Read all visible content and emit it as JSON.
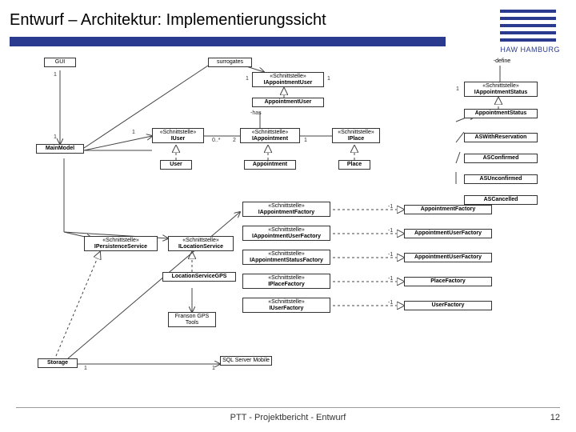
{
  "header": {
    "title": "Entwurf – Architektur: Implementierungssicht"
  },
  "logo": {
    "text": "HAW HAMBURG"
  },
  "footer": {
    "center": "PTT - Projektbericht - Entwurf",
    "page": "12"
  },
  "diagram": {
    "boxes": {
      "gui": "GUI",
      "surrogates": "surrogates",
      "define": "-define",
      "iappuser_s": "«Schnittstelle»",
      "iappuser": "IAppointmentUser",
      "appuser": "AppointmentUser",
      "iappstatus_s": "«Schnittstelle»",
      "iappstatus": "IAppointmentStatus",
      "appstatus": "AppointmentStatus",
      "mainmodel": "MainModel",
      "iuser_s": "«Schnittstelle»",
      "iuser": "IUser",
      "iapp_s": "«Schnittstelle»",
      "iapp": "IAppointment",
      "iplace_s": "«Schnittstelle»",
      "iplace": "IPlace",
      "has": "-has",
      "user": "User",
      "appointment": "Appointment",
      "place": "Place",
      "aswithres": "ASWithReservation",
      "asconfirmed": "ASConfirmed",
      "asunconf": "ASUnconfirmed",
      "ascancelled": "ASCancelled",
      "ipersist_s": "«Schnittstelle»",
      "ipersist": "IPersistenceService",
      "iloc_s": "«Schnittstelle»",
      "iloc": "ILocationService",
      "iappfact_s": "«Schnittstelle»",
      "iappfact": "IAppointmentFactory",
      "appfact": "AppointmentFactory",
      "iappuserfact_s": "«Schnittstelle»",
      "iappuserfact": "IAppointmentUserFactory",
      "appuserfact": "AppointmentUserFactory",
      "iappstatfact_s": "«Schnittstelle»",
      "iappstatfact": "IAppointmentStatusFactory",
      "appstatfact": "AppointmentUserFactory",
      "iplacefact_s": "«Schnittstelle»",
      "iplacefact": "IPlaceFactory",
      "placefact": "PlaceFactory",
      "iuserfact_s": "«Schnittstelle»",
      "iuserfact": "IUserFactory",
      "userfact": "UserFactory",
      "locservice": "LocationServiceGPS",
      "franson": "Franson\nGPS Tools",
      "storage": "Storage",
      "sqlserver": "SQL Server\nMobile"
    },
    "mult": {
      "m1": "1",
      "m2": "1",
      "m3": "1",
      "m4": "1",
      "m5": "0..*",
      "m6": "2",
      "m7": "1",
      "m8": "-1",
      "m9": "-1",
      "m10": "-1",
      "m11": "-1",
      "m12": "-1",
      "m13": "1",
      "m14": "1",
      "m15": "1",
      "m16": "1"
    }
  }
}
